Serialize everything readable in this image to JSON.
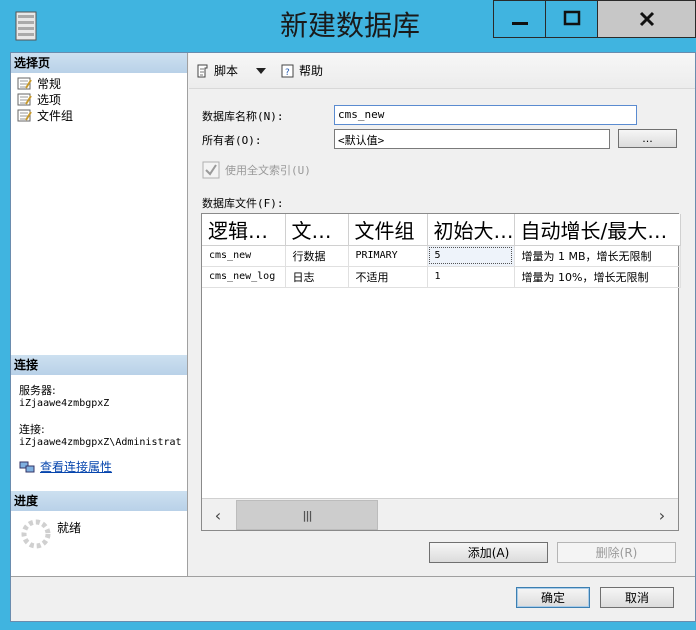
{
  "window": {
    "title": "新建数据库",
    "min_glyph": "—",
    "max_glyph": "□",
    "close_glyph": "✕"
  },
  "sidebar": {
    "select_page_header": "选择页",
    "items": [
      {
        "label": "常规"
      },
      {
        "label": "选项"
      },
      {
        "label": "文件组"
      }
    ],
    "connection_header": "连接",
    "server_label": "服务器:",
    "server_value": "iZjaawe4zmbgpxZ",
    "connection_label": "连接:",
    "connection_value": "iZjaawe4zmbgpxZ\\Administrat",
    "view_connection_link": "查看连接属性",
    "progress_header": "进度",
    "progress_status": "就绪"
  },
  "toolbar": {
    "script_label": "脚本",
    "help_label": "帮助"
  },
  "form": {
    "db_name_label": "数据库名称(N):",
    "db_name_value": "cms_new",
    "owner_label": "所有者(O):",
    "owner_value": "<默认值>",
    "owner_browse": "...",
    "fulltext_label": "使用全文索引(U)",
    "fulltext_checked": true,
    "files_label": "数据库文件(F):"
  },
  "files_table": {
    "columns": [
      "逻辑名称",
      "文件类型",
      "文件组",
      "初始大小(MB)",
      "自动增长/最大大小"
    ],
    "rows": [
      [
        "cms_new",
        "行数据",
        "PRIMARY",
        "5",
        "增量为 1 MB，增长无限制"
      ],
      [
        "cms_new_log",
        "日志",
        "不适用",
        "1",
        "增量为 10%，增长无限制"
      ]
    ]
  },
  "buttons": {
    "add": "添加(A)",
    "remove": "删除(R)",
    "ok": "确定",
    "cancel": "取消"
  },
  "scrollbar": {
    "left_glyph": "‹",
    "right_glyph": "›",
    "thumb_glyph": "|||"
  }
}
